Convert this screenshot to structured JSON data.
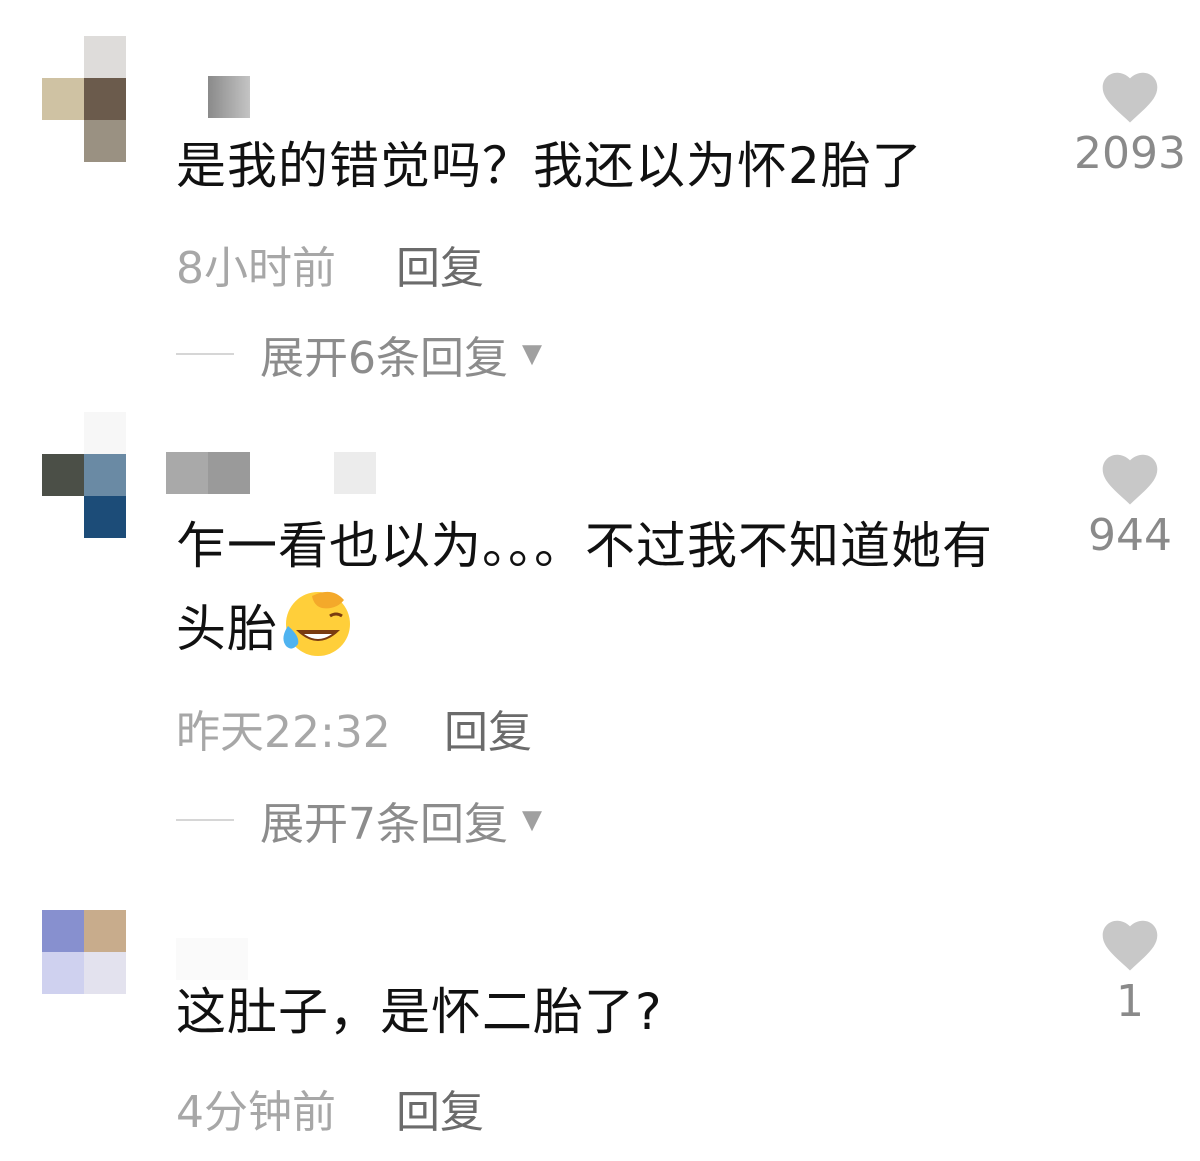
{
  "comments": [
    {
      "text": "是我的错觉吗？我还以为怀2胎了",
      "time": "8小时前",
      "reply_label": "回复",
      "expand_label": "展开6条回复",
      "likes": "2093",
      "emoji": null
    },
    {
      "text": "乍一看也以为。。。不过我不知道她有头胎",
      "time": "昨天22:32",
      "reply_label": "回复",
      "expand_label": "展开7条回复",
      "likes": "944",
      "emoji": "facepalm-laugh-cry"
    },
    {
      "text": "这肚子，是怀二胎了?",
      "time": "4分钟前",
      "reply_label": "回复",
      "likes": "1",
      "emoji": null
    }
  ],
  "icons": {
    "like": "heart-icon",
    "expand": "caret-down-icon"
  },
  "colors": {
    "text_primary": "#111111",
    "text_meta": "#a7a7a7",
    "text_reply": "#6b6b6b",
    "heart": "#c8c8c8"
  }
}
